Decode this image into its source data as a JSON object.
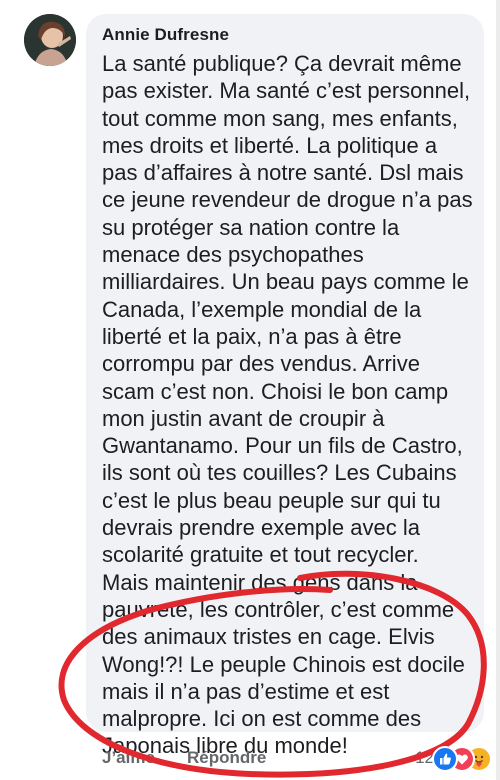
{
  "comment": {
    "author": "Annie Dufresne",
    "lines": [
      "La santé publique? Ça devrait même",
      "pas exister. Ma santé c’est personnel,",
      "tout comme mon sang, mes enfants,",
      "mes droits et liberté. La politique a",
      "pas d’affaires à notre santé. Dsl mais",
      "ce jeune revendeur de drogue n’a pas",
      "su protéger sa nation contre la",
      "menace des psychopathes",
      "milliardaires. Un beau pays comme le",
      "Canada, l’exemple mondial de la",
      "liberté et la paix, n’a pas à être",
      "corrompu par des vendus. Arrive",
      "scam c’est non. Choisi le bon camp",
      "mon justin avant de croupir à",
      "Gwantanamo. Pour un fils de Castro,",
      "ils sont où tes couilles? Les Cubains",
      "c’est le plus beau peuple sur qui tu",
      "devrais prendre exemple avec la",
      "scolarité gratuite et tout recycler.",
      "Mais maintenir des gens dans la",
      "pauvreté, les contrôler, c’est comme",
      "des animaux tristes en cage. Elvis",
      "Wong!?! Le peuple Chinois est docile",
      "mais il n’a pas d’estime et est",
      "malpropre. Ici on est comme des",
      "Japonais libre du monde!"
    ]
  },
  "actions": {
    "like_label": "J’aime",
    "reply_label": "Répondre",
    "reaction_count": "12"
  },
  "icons": {
    "avatar": "user-avatar",
    "reactions": [
      "like-reaction-icon",
      "love-reaction-icon",
      "care-reaction-icon"
    ]
  },
  "colors": {
    "bubble": "#f0f2f5",
    "text": "#1c1e21",
    "meta": "#65676b",
    "annotation": "#e0282e"
  }
}
